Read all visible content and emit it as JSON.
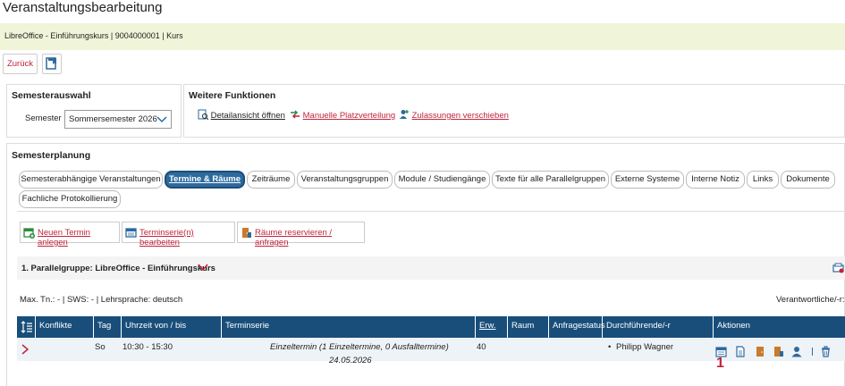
{
  "page_title": "Veranstaltungsbearbeitung",
  "info_bar": "LibreOffice - Einführungskurs | 9004000001 | Kurs",
  "toolbar": {
    "back_label": "Zurück"
  },
  "semester_panel": {
    "title": "Semesterauswahl",
    "semester_label": "Semester",
    "semester_value": "Sommersemester 2026"
  },
  "functions_panel": {
    "title": "Weitere Funktionen",
    "links": [
      "Detailansicht öffnen",
      "Manuelle Platzverteilung",
      "Zulassungen verschieben"
    ]
  },
  "planning": {
    "title": "Semesterplanung",
    "tabs": [
      "Semesterabhängige Veranstaltungen",
      "Termine & Räume",
      "Zeiträume",
      "Veranstaltungsgruppen",
      "Module / Studiengänge",
      "Texte für alle Parallelgruppen",
      "Externe Systeme",
      "Interne Notiz",
      "Links",
      "Dokumente",
      "Fachliche Protokollierung"
    ],
    "active_tab": "Termine & Räume"
  },
  "actions": [
    "Neuen Termin anlegen",
    "Terminserie(n) bearbeiten",
    "Räume reservieren / anfragen"
  ],
  "group": {
    "title": "1. Parallelgruppe: LibreOffice - Einführungskurs",
    "meta": "Max. Tn.: - | SWS: - | Lehrsprache: deutsch",
    "responsible_label": "Verantwortliche/-r:"
  },
  "table": {
    "headers": [
      "Konflikte",
      "Tag",
      "Uhrzeit von / bis",
      "Terminserie",
      "Erw. Tn.",
      "Raum",
      "Anfragestatus",
      "Durchführende/-r",
      "Aktionen"
    ],
    "row": {
      "day": "So",
      "time": "10:30 - 15:30",
      "series": "Einzeltermin (1 Einzeltermine, 0 Ausfalltermine)",
      "series_date": "24.05.2026",
      "expected": "40",
      "room": "",
      "status": "",
      "person": "Philipp Wagner"
    }
  },
  "annotation_marker": "1",
  "colors": {
    "header_bg": "#194e7a",
    "active_tab": "#2d6a9e",
    "info_bg": "#f0f5d9",
    "accent_red": "#c0243c"
  }
}
